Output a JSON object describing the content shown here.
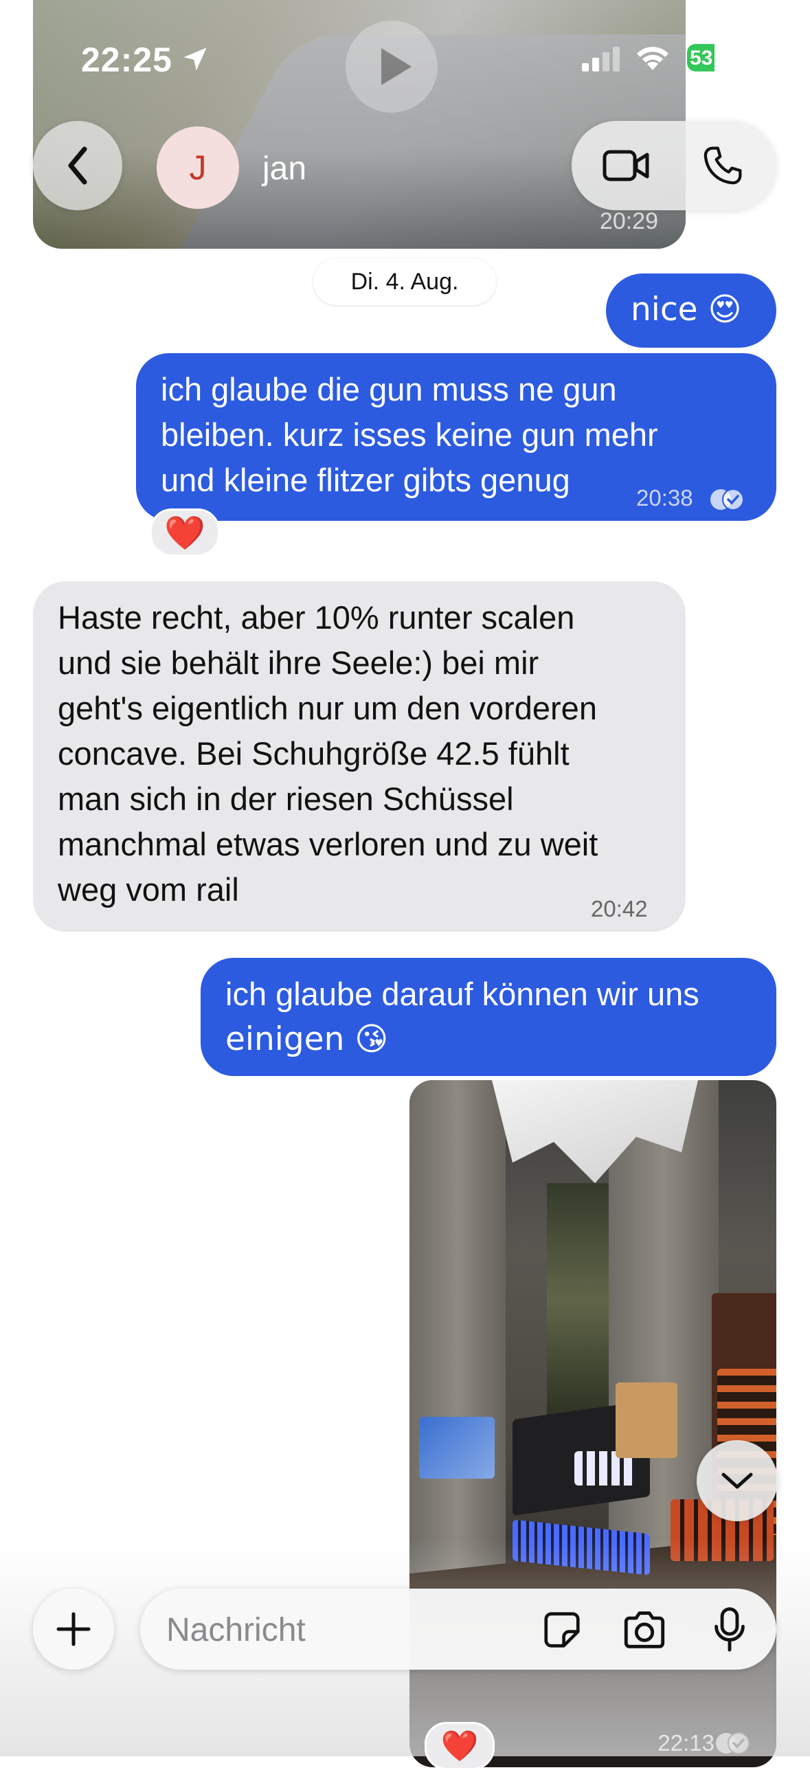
{
  "status_bar": {
    "time": "22:25",
    "battery_percent": "53",
    "battery_level": 0.53,
    "charging": true
  },
  "header": {
    "avatar_initial": "J",
    "contact_name": "jan"
  },
  "video_message": {
    "time": "20:29"
  },
  "date_separator": "Di. 4. Aug.",
  "messages": [
    {
      "direction": "outgoing",
      "text": "nice 😍"
    },
    {
      "direction": "outgoing",
      "lines": [
        "ich glaube die gun muss ne gun",
        "bleiben. kurz isses keine gun mehr",
        "und kleine flitzer gibts genug"
      ],
      "time": "20:38",
      "status": "read",
      "reaction": "❤️"
    },
    {
      "direction": "incoming",
      "lines": [
        "Haste recht, aber 10% runter scalen",
        "und  sie behält ihre Seele:) bei mir",
        "geht's eigentlich nur um den vorderen",
        "concave. Bei Schuhgröße 42.5 fühlt",
        "man sich in der riesen Schüssel",
        "manchmal etwas verloren und zu weit",
        "weg vom rail"
      ],
      "time": "20:42"
    },
    {
      "direction": "outgoing",
      "lines": [
        "ich glaube darauf können wir uns",
        "einigen 😘"
      ]
    },
    {
      "direction": "outgoing",
      "type": "photo",
      "time": "22:13",
      "status": "read",
      "reaction": "❤️"
    }
  ],
  "composer": {
    "placeholder": "Nachricht"
  },
  "icons": {
    "back": "chevron-left-icon",
    "video_call": "video-camera-icon",
    "phone_call": "phone-icon",
    "add": "plus-icon",
    "sticker": "sticker-icon",
    "camera": "camera-icon",
    "mic": "microphone-icon",
    "scroll_down": "chevron-down-icon",
    "location": "location-arrow-icon"
  },
  "colors": {
    "outgoing_bubble": "#2c5be0",
    "incoming_bubble": "#e8e8ea",
    "reaction_heart": "#e0112b"
  }
}
